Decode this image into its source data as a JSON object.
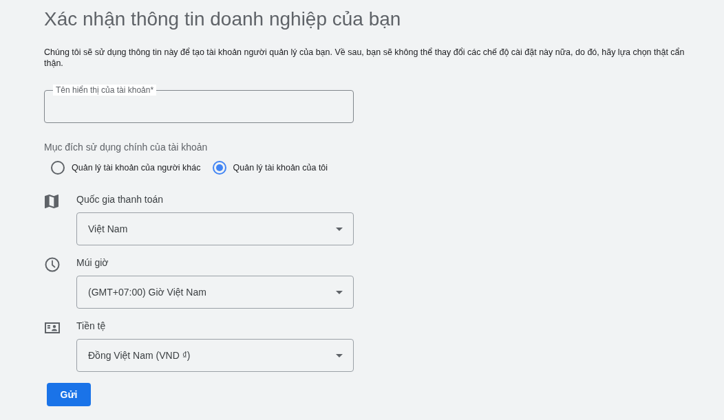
{
  "page": {
    "title": "Xác nhận thông tin doanh nghiệp của bạn",
    "description": "Chúng tôi sẽ sử dụng thông tin này để tạo tài khoản người quản lý của bạn. Về sau, bạn sẽ không thể thay đổi các chế độ cài đặt này nữa, do đó, hãy lựa chọn thật cẩn thận."
  },
  "display_name_field": {
    "label": "Tên hiển thị của tài khoản*"
  },
  "purpose": {
    "label": "Mục đích sử dụng chính của tài khoản",
    "options": [
      {
        "label": "Quản lý tài khoản của người khác",
        "selected": false
      },
      {
        "label": "Quản lý tài khoản của tôi",
        "selected": true
      }
    ]
  },
  "settings": [
    {
      "kind": "map",
      "label": "Quốc gia thanh toán",
      "value": "Việt Nam"
    },
    {
      "kind": "clock",
      "label": "Múi giờ",
      "value": "(GMT+07:00) Giờ Việt Nam"
    },
    {
      "kind": "currency",
      "label": "Tiền tệ",
      "value": "Đồng Việt Nam (VND ₫)"
    }
  ],
  "submit_button": {
    "label": "Gửi"
  }
}
